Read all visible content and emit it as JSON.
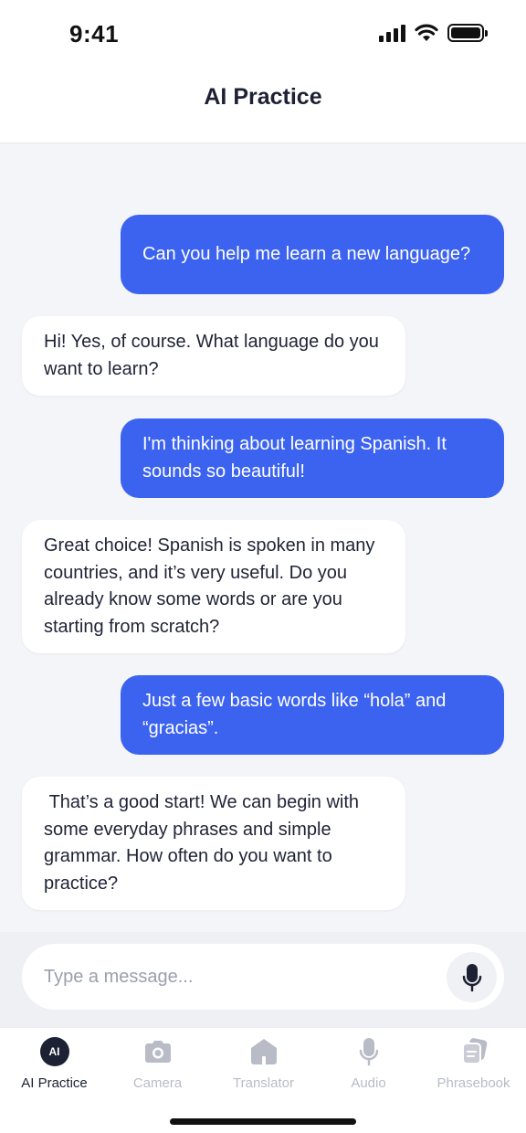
{
  "status_bar": {
    "time": "9:41"
  },
  "header": {
    "title": "AI Practice"
  },
  "messages": [
    {
      "role": "user",
      "text": "Can you help me learn a new language?"
    },
    {
      "role": "ai",
      "text": "Hi! Yes, of course. What language do you want to learn?"
    },
    {
      "role": "user",
      "text": "I'm thinking about learning Spanish. It sounds so beautiful!"
    },
    {
      "role": "ai",
      "text": "Great choice! Spanish is spoken in many countries, and it’s very useful. Do you already know some words or are you starting from scratch?"
    },
    {
      "role": "user",
      "text": "Just a few basic words like “hola” and “gracias”."
    },
    {
      "role": "ai",
      "text": " That’s a good start! We can begin with some everyday phrases and simple grammar. How often do you want to practice?"
    }
  ],
  "composer": {
    "placeholder": "Type a message...",
    "value": ""
  },
  "tabs": [
    {
      "label": "AI Practice",
      "icon": "ai-badge-icon",
      "badge_text": "AI",
      "active": true
    },
    {
      "label": "Camera",
      "icon": "camera-icon",
      "active": false
    },
    {
      "label": "Translator",
      "icon": "home-icon",
      "active": false
    },
    {
      "label": "Audio",
      "icon": "microphone-icon",
      "active": false
    },
    {
      "label": "Phrasebook",
      "icon": "phrasebook-icon",
      "active": false
    }
  ],
  "colors": {
    "user_bubble": "#3c63f0",
    "ai_bubble": "#ffffff",
    "background": "#f4f5f8",
    "active_tab": "#1c2234",
    "inactive_tab": "#b8bcc6"
  }
}
